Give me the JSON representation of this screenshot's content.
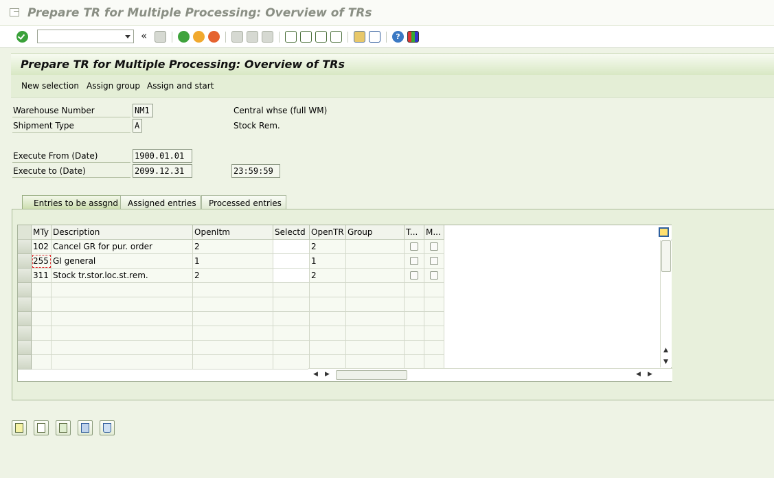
{
  "window": {
    "title": "Prepare TR for Multiple Processing: Overview of TRs"
  },
  "toolbar": {
    "command_value": "",
    "icons": [
      "enter-icon",
      "save-icon",
      "back-icon",
      "exit-icon",
      "cancel-icon",
      "print-icon",
      "find-icon",
      "find-next-icon",
      "first-page-icon",
      "previous-page-icon",
      "next-page-icon",
      "last-page-icon",
      "create-session-icon",
      "shortcut-icon",
      "help-icon",
      "customize-layout-icon"
    ]
  },
  "header": {
    "title": "Prepare TR for Multiple Processing: Overview of TRs"
  },
  "appbar": {
    "buttons": [
      "New selection",
      "Assign group",
      "Assign and start"
    ]
  },
  "form": {
    "warehouse_label": "Warehouse Number",
    "warehouse_value": "NM1",
    "warehouse_desc": "Central whse (full WM)",
    "shipment_label": "Shipment Type",
    "shipment_value": "A",
    "shipment_desc": "Stock Rem.",
    "exec_from_label": "Execute From (Date)",
    "exec_from_value": "1900.01.01",
    "exec_to_label": "Execute to (Date)",
    "exec_to_value": "2099.12.31",
    "exec_to_time": "23:59:59"
  },
  "tabs": [
    "Entries to be assgnd",
    "Assigned entries",
    "Processed entries"
  ],
  "grid": {
    "columns": [
      "MTy",
      "Description",
      "OpenItm",
      "Selectd",
      "OpenTR",
      "Group",
      "T...",
      "M..."
    ],
    "rows": [
      {
        "mty": "102",
        "desc": "Cancel GR for pur. order",
        "openitm": "2",
        "selectd": "",
        "opentr": "2",
        "group": ""
      },
      {
        "mty": "255",
        "desc": "GI general",
        "openitm": "1",
        "selectd": "",
        "opentr": "1",
        "group": ""
      },
      {
        "mty": "311",
        "desc": "Stock tr.stor.loc.st.rem.",
        "openitm": "2",
        "selectd": "",
        "opentr": "2",
        "group": ""
      }
    ],
    "empty_rows": 6
  },
  "bottom_buttons": [
    "details-icon",
    "change-icon",
    "display-icon",
    "calculator-icon",
    "delete-icon"
  ]
}
